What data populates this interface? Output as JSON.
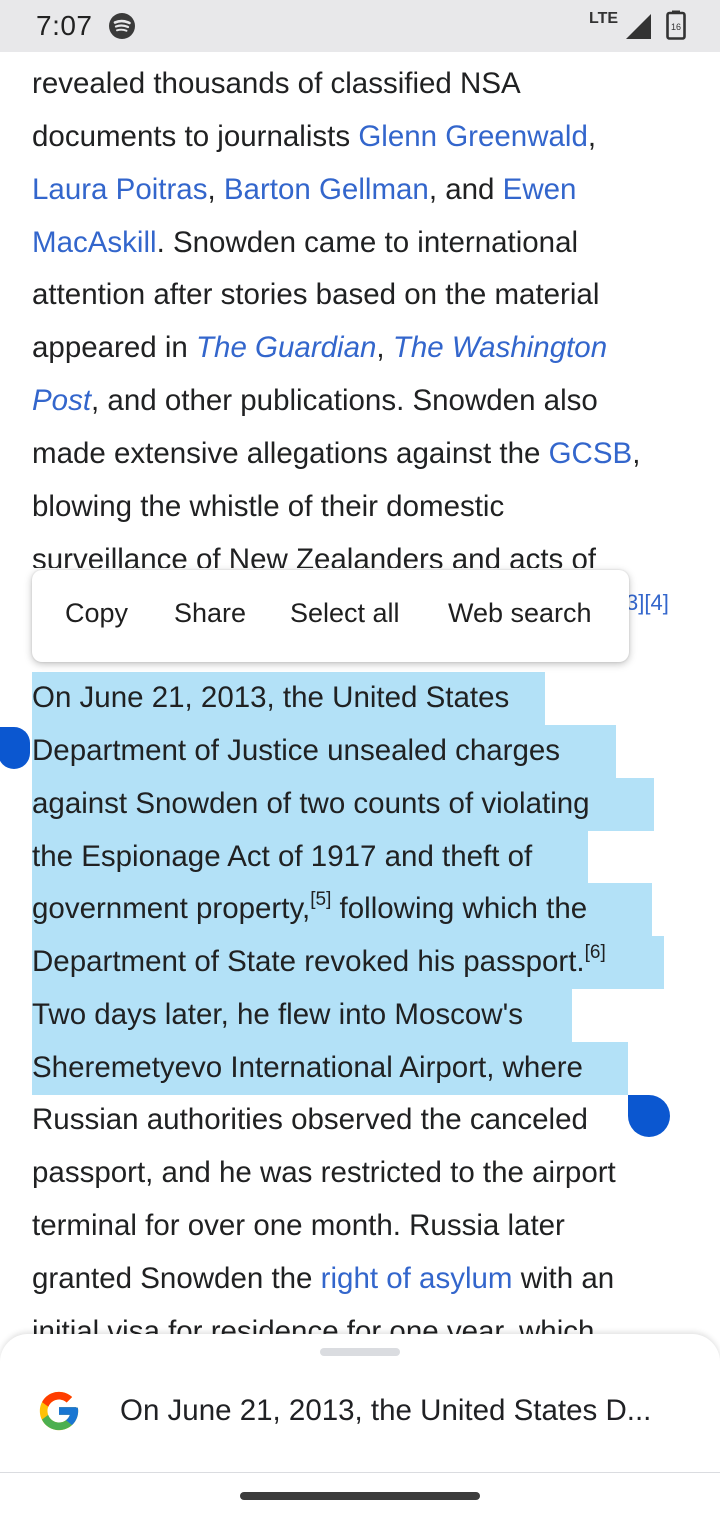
{
  "status_bar": {
    "time": "7:07",
    "network": "LTE",
    "battery_level": "16",
    "icons": [
      "spotify-icon",
      "signal-icon",
      "battery-icon"
    ]
  },
  "article": {
    "p1": {
      "l1": "revealed thousands of classified NSA",
      "l2a": "documents to journalists ",
      "l2_link": "Glenn Greenwald",
      "l2b": ",",
      "l3_link1": "Laura Poitras",
      "l3a": ", ",
      "l3_link2": "Barton Gellman",
      "l3b": ", and ",
      "l3_link3": "Ewen",
      "l4_link": "MacAskill",
      "l4a": ". Snowden came to international",
      "l5": "attention after stories based on the material",
      "l6a": "appeared in ",
      "l6_link1": "The Guardian",
      "l6b": ", ",
      "l6_link2": "The Washington",
      "l7_link": "Post",
      "l7a": ", and other publications. Snowden also",
      "l8a": "made extensive allegations against the ",
      "l8_link": "GCSB",
      "l8b": ",",
      "l9": "blowing the whistle of their domestic",
      "l10": "surveillance of New Zealanders and acts of",
      "refs_peek": "3][4]"
    },
    "p2": {
      "l1": "On June 21, 2013, the United States",
      "l2": "Department of Justice unsealed charges",
      "l3": "against Snowden of two counts of violating",
      "l4": "the Espionage Act of 1917 and theft of",
      "l5a": "government property,",
      "l5_ref": "[5]",
      "l5b": " following which the",
      "l6a": "Department of State revoked his passport.",
      "l6_ref": "[6]",
      "l7": "Two days later, he flew into Moscow's",
      "l8": "Sheremetyevo International Airport, where",
      "l9": "Russian authorities observed the canceled",
      "l10": "passport, and he was restricted to the airport",
      "l11": "terminal for over one month. Russia later",
      "l12a": "granted Snowden the ",
      "l12_link": "right of asylum",
      "l12b": " with an",
      "l13": "initial visa for residence for one year, which"
    }
  },
  "context_menu": {
    "copy": "Copy",
    "share": "Share",
    "select_all": "Select all",
    "web_search": "Web search"
  },
  "search_sheet": {
    "query": "On June 21, 2013, the United States D..."
  },
  "colors": {
    "link": "#3366cc",
    "selection": "#b3e1f7",
    "handle": "#0b57d0",
    "status_bar": "#e8e8ea"
  }
}
